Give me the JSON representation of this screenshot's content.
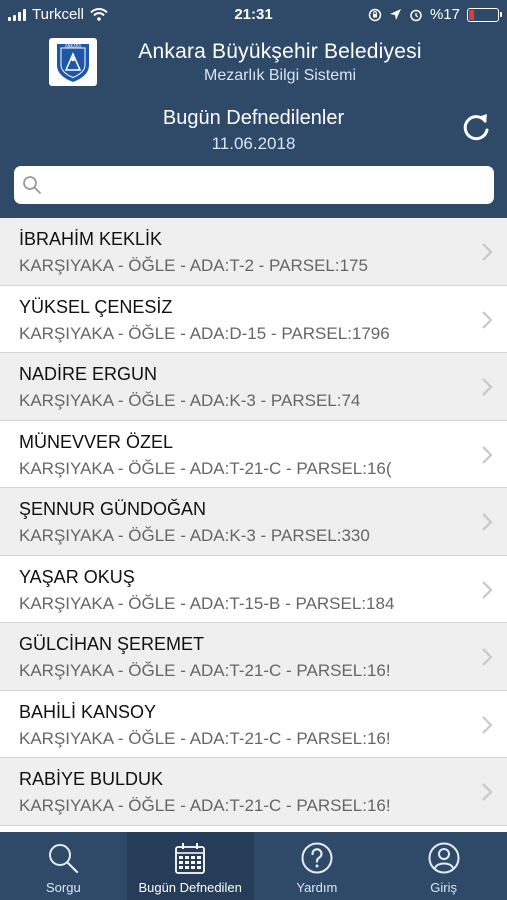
{
  "status_bar": {
    "carrier": "Turkcell",
    "time": "21:31",
    "battery": "%17",
    "battery_level": 0.17
  },
  "header": {
    "app_title": "Ankara Büyükşehir Belediyesi",
    "app_subtitle": "Mezarlık Bilgi Sistemi",
    "logo_text": "ANKARA",
    "page_title": "Bugün Defnedilenler",
    "date": "11.06.2018"
  },
  "search": {
    "placeholder": "",
    "value": ""
  },
  "rows": [
    {
      "name": "İBRAHİM KEKLİK",
      "detail": "KARŞIYAKA - ÖĞLE - ADA:T-2 - PARSEL:175"
    },
    {
      "name": "YÜKSEL ÇENESİZ",
      "detail": "KARŞIYAKA - ÖĞLE - ADA:D-15 - PARSEL:1796"
    },
    {
      "name": "NADİRE ERGUN",
      "detail": "KARŞIYAKA - ÖĞLE - ADA:K-3 - PARSEL:74"
    },
    {
      "name": "MÜNEVVER ÖZEL",
      "detail": "KARŞIYAKA - ÖĞLE - ADA:T-21-C - PARSEL:16("
    },
    {
      "name": "ŞENNUR GÜNDOĞAN",
      "detail": "KARŞIYAKA - ÖĞLE - ADA:K-3 - PARSEL:330"
    },
    {
      "name": "YAŞAR OKUŞ",
      "detail": "KARŞIYAKA - ÖĞLE - ADA:T-15-B - PARSEL:184"
    },
    {
      "name": "GÜLCİHAN ŞEREMET",
      "detail": "KARŞIYAKA - ÖĞLE - ADA:T-21-C - PARSEL:16!"
    },
    {
      "name": "BAHİLİ KANSOY",
      "detail": "KARŞIYAKA - ÖĞLE - ADA:T-21-C - PARSEL:16!"
    },
    {
      "name": "RABİYE BULDUK",
      "detail": "KARŞIYAKA - ÖĞLE - ADA:T-21-C - PARSEL:16!"
    }
  ],
  "tabs": [
    {
      "label": "Sorgu",
      "icon": "search-icon"
    },
    {
      "label": "Bugün Defnedilen",
      "icon": "calendar-icon"
    },
    {
      "label": "Yardım",
      "icon": "help-icon"
    },
    {
      "label": "Giriş",
      "icon": "user-icon"
    }
  ],
  "colors": {
    "header_bg": "#2f4a69",
    "tab_active_bg": "#253d58",
    "battery_low": "#e53935"
  }
}
